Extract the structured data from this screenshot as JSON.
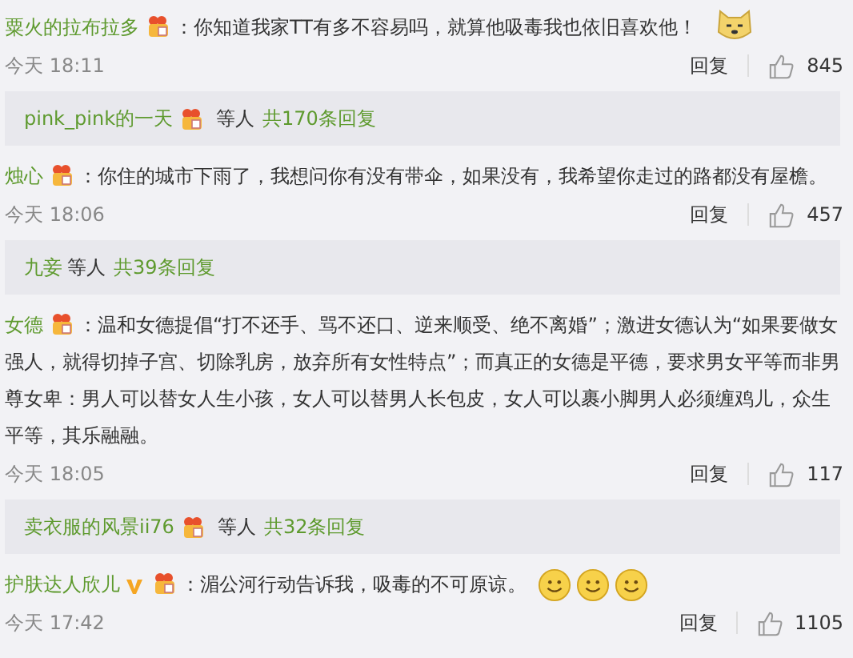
{
  "comments": [
    {
      "user": "粟火的拉布拉多",
      "badge": true,
      "verified": false,
      "text": "：你知道我家TT有多不容易吗，就算他吸毒我也依旧喜欢他！",
      "emojis": [
        {
          "kind": "dog"
        }
      ],
      "time": "今天 18:11",
      "reply": "回复",
      "likes": "845",
      "replies": {
        "user": "pink_pink的一天",
        "badge": true,
        "others": "等人",
        "total": "共170条回复"
      }
    },
    {
      "user": "烛心",
      "badge": true,
      "verified": false,
      "text": "：你住的城市下雨了，我想问你有没有带伞，如果没有，我希望你走过的路都没有屋檐。",
      "time": "今天 18:06",
      "reply": "回复",
      "likes": "457",
      "replies": {
        "user": "九妾",
        "badge": false,
        "others": "等人",
        "total": "共39条回复"
      }
    },
    {
      "user": "女德",
      "badge": true,
      "verified": false,
      "text": "：温和女德提倡“打不还手、骂不还口、逆来顺受、绝不离婚”；激进女德认为“如果要做女强人，就得切掉子宫、切除乳房，放弃所有女性特点”；而真正的女德是平德，要求男女平等而非男尊女卑：男人可以替女人生小孩，女人可以替男人长包皮，女人可以裹小脚男人必须缠鸡儿，众生平等，其乐融融。",
      "time": "今天 18:05",
      "reply": "回复",
      "likes": "117",
      "replies": {
        "user": "卖衣服的风景ii76",
        "badge": true,
        "others": "等人",
        "total": "共32条回复"
      }
    },
    {
      "user": "护肤达人欣儿",
      "badge": true,
      "verified": true,
      "text": "：湄公河行动告诉我，吸毒的不可原谅。",
      "emojis": [
        {
          "kind": "smile"
        },
        {
          "kind": "smile"
        },
        {
          "kind": "smile"
        }
      ],
      "time": "今天 17:42",
      "reply": "回复",
      "likes": "1105"
    }
  ]
}
